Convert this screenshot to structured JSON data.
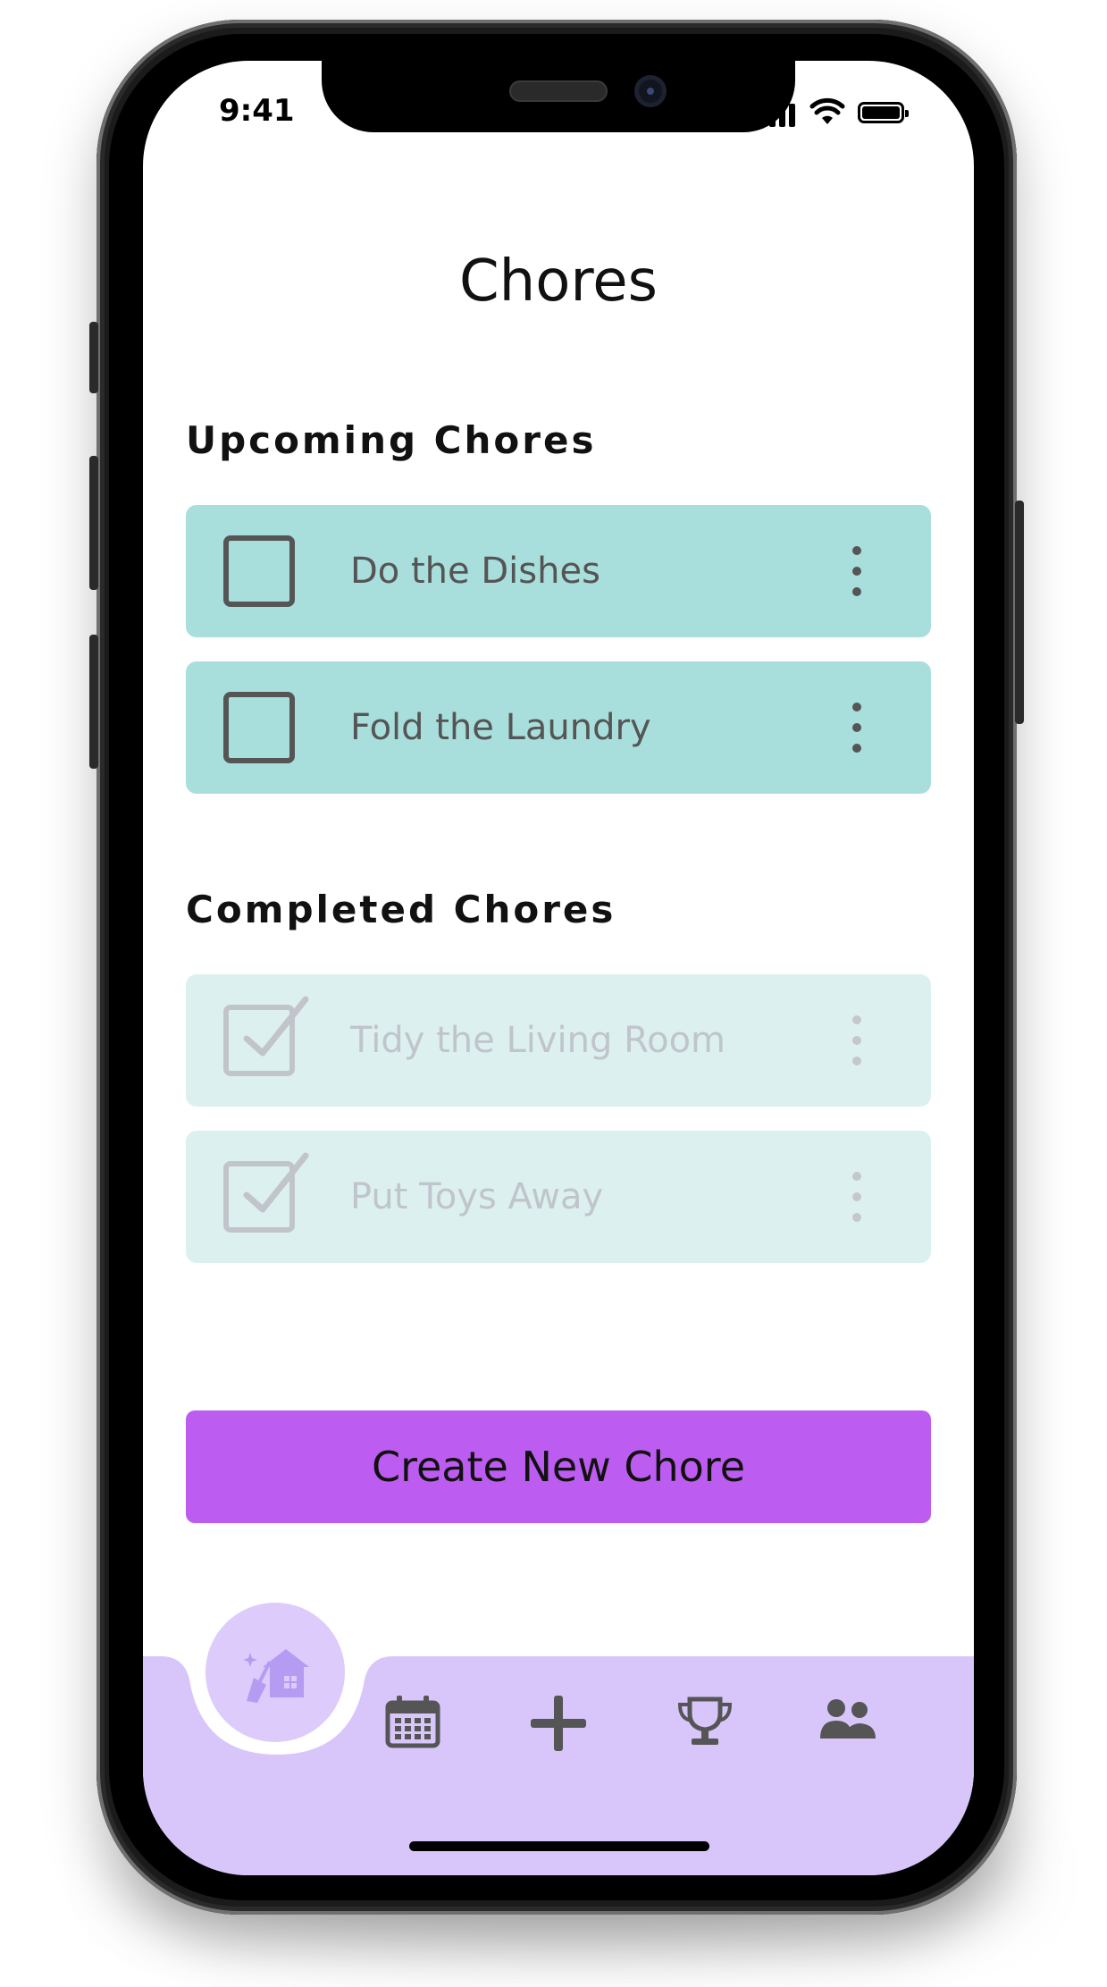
{
  "status_bar": {
    "time": "9:41"
  },
  "page": {
    "title": "Chores"
  },
  "upcoming": {
    "heading": "Upcoming Chores",
    "items": [
      {
        "label": "Do the Dishes",
        "checked": false
      },
      {
        "label": "Fold the Laundry",
        "checked": false
      }
    ]
  },
  "completed": {
    "heading": "Completed Chores",
    "items": [
      {
        "label": "Tidy the Living Room",
        "checked": true
      },
      {
        "label": "Put Toys Away",
        "checked": true
      }
    ]
  },
  "actions": {
    "create_label": "Create New Chore"
  },
  "nav": {
    "items": [
      "chores-home-icon",
      "calendar-icon",
      "add-icon",
      "trophy-icon",
      "people-icon"
    ],
    "active": "chores-home-icon"
  },
  "colors": {
    "upcoming_card": "#a8dedc",
    "completed_card": "#dcf1ef",
    "primary_button": "#bd5cf0",
    "nav_background": "#d8c6fa",
    "nav_active_circle": "#dccbfb"
  }
}
